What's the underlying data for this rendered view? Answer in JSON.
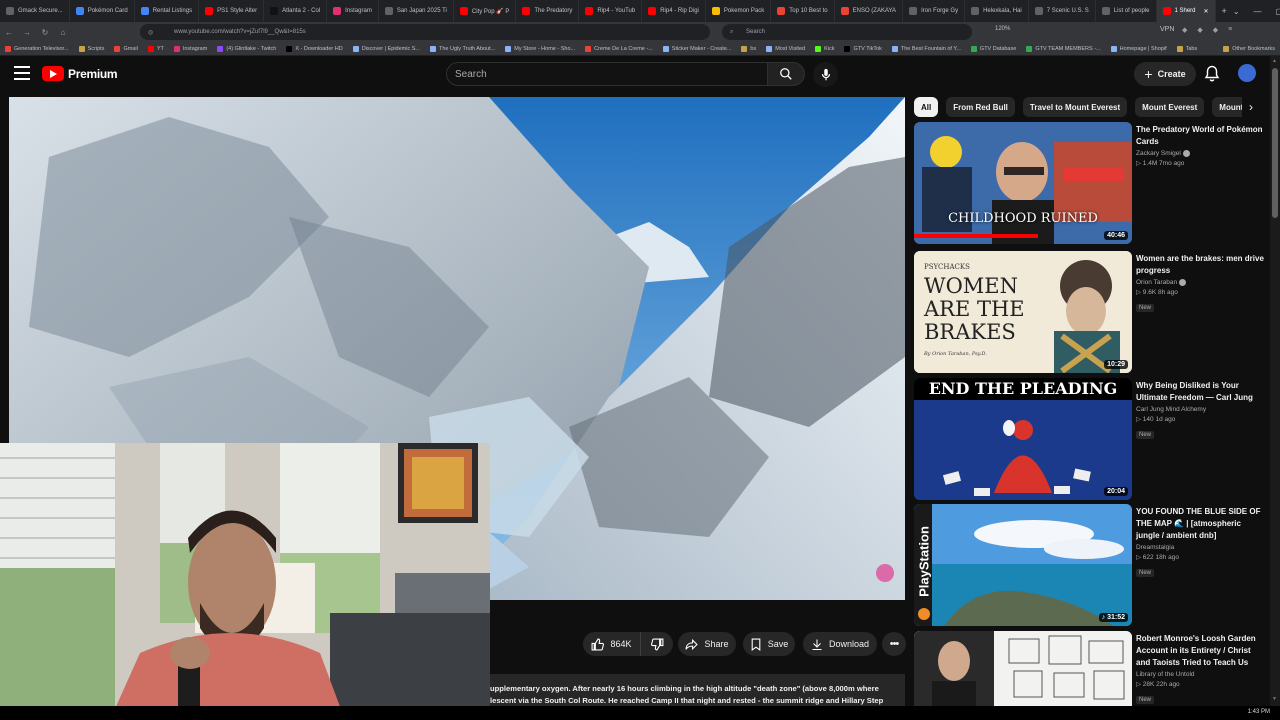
{
  "browser": {
    "tabs": [
      {
        "label": "Gmack Secure..."
      },
      {
        "label": "Pokémon Card"
      },
      {
        "label": "Rental Listings"
      },
      {
        "label": "PS1 Style Alter"
      },
      {
        "label": "Atlanta 2 - Col"
      },
      {
        "label": "Instagram"
      },
      {
        "label": "San Japan 2025 Ti"
      },
      {
        "label": "City Pop 🎸 P"
      },
      {
        "label": "The Predatory"
      },
      {
        "label": "Rip4 - YouTub"
      },
      {
        "label": "Rip4 - Rip Digi"
      },
      {
        "label": "Pokemon Pack"
      },
      {
        "label": "Top 10 Best to"
      },
      {
        "label": "ENSO (ZAKAYA"
      },
      {
        "label": "Iron Forge Gy"
      },
      {
        "label": "Helexkala, Hai"
      },
      {
        "label": "7 Scenic U.S. S"
      },
      {
        "label": "List of people"
      },
      {
        "label": "1 Sherd",
        "active": true
      }
    ],
    "url": "www.youtube.com/watch?v=jZuf7l9__Qw&t=815s",
    "search_placeholder": "Search",
    "zoom": "120%",
    "vpn": "VPN",
    "bookmarks": [
      "Generation Televisor...",
      "Scripts",
      "Gmail",
      "YT",
      "Instagram",
      "(4) Glintlake - Twitch",
      "X - Downloader HD",
      "Discover | Epidemic S...",
      "The Ugly Truth About...",
      "My Store - Home - Sho...",
      "Creme De La Creme -...",
      "Sticker Maker - Create...",
      "bs",
      "Most Visited",
      "Kick",
      "GTV TikTok",
      "The Best Fountain of Y...",
      "GTV Database",
      "GTV TEAM MEMBERS -...",
      "Homepage | Shopif",
      "Tabs"
    ],
    "other_bookmarks": "Other Bookmarks"
  },
  "youtube": {
    "logo_text": "Premium",
    "search_placeholder": "Search",
    "create_label": "Create"
  },
  "actions": {
    "like_count": "864K",
    "share": "Share",
    "save": "Save",
    "download": "Download"
  },
  "description": {
    "line1": "upplementary oxygen. After nearly 16 hours climbing in the high altitude \"death zone\" (above 8,000m where",
    "line2": "lescent via the South Col Route. He reached Camp II that night and rested - the summit ridge and Hillary Step"
  },
  "chips": [
    "All",
    "From Red Bull",
    "Travel to Mount Everest",
    "Mount Everest",
    "Mount"
  ],
  "recommendations": [
    {
      "title": "The Predatory World of Pokémon Cards",
      "channel": "Zackary Smigel",
      "verified": true,
      "stats": "▷ 1.4M  7mo ago",
      "badge": "",
      "duration": "40:46",
      "thumb_text": "CHILDHOOD RUINED"
    },
    {
      "title": "Women are the brakes: men drive progress",
      "channel": "Orion Taraban",
      "verified": true,
      "stats": "▷ 9.6K  8h ago",
      "badge": "New",
      "duration": "10:29",
      "thumb_kicker": "PSYCHACKS",
      "thumb_text": "WOMEN ARE THE BRAKES",
      "thumb_byline": "By Orion Taraban, Psy.D."
    },
    {
      "title": "Why Being Disliked is Your Ultimate Freedom — Carl Jung",
      "channel": "Carl Jung Mind Alchemy",
      "verified": false,
      "stats": "▷ 140  1d ago",
      "badge": "New",
      "duration": "20:04",
      "thumb_text": "END THE PLEADING"
    },
    {
      "title": "YOU FOUND THE BLUE SIDE OF THE MAP 🌊 | [atmospheric jungle / ambient dnb]",
      "channel": "Dreamstalgia",
      "verified": false,
      "stats": "▷ 622  18h ago",
      "badge": "New",
      "duration": "♪ 31:52",
      "thumb_text": "PlayStation"
    },
    {
      "title": "Robert Monroe's Loosh Garden Account in its Entirety / Christ and Taoists Tried to Teach Us",
      "channel": "Library of the Untold",
      "verified": false,
      "stats": "▷ 28K  22h ago",
      "badge": "New",
      "duration": "",
      "thumb_text": ""
    }
  ],
  "taskbar": {
    "clock": "1:43 PM"
  }
}
